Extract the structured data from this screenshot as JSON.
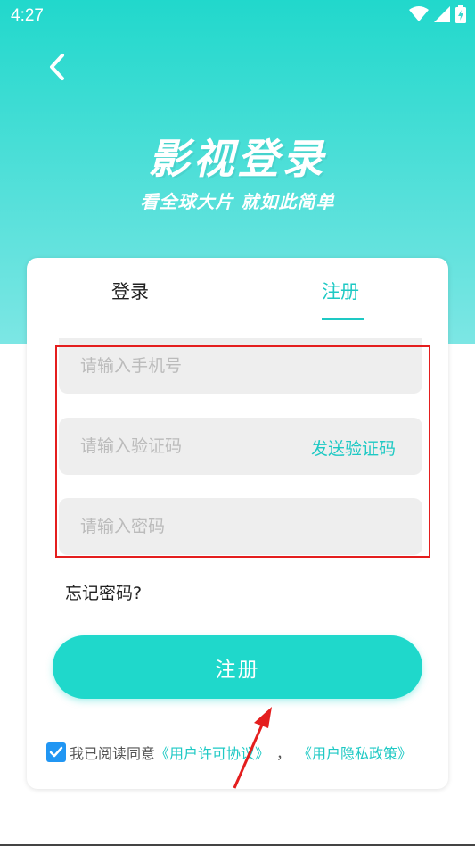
{
  "status_bar": {
    "time": "4:27"
  },
  "header": {
    "title": "影视登录",
    "subtitle": "看全球大片 就如此简单"
  },
  "tabs": {
    "login": "登录",
    "register": "注册"
  },
  "form": {
    "phone_placeholder": "请输入手机号",
    "code_placeholder": "请输入验证码",
    "send_code": "发送验证码",
    "password_placeholder": "请输入密码"
  },
  "forgot_password": "忘记密码?",
  "submit_label": "注册",
  "agreement": {
    "prefix": "我已阅读同意",
    "license": "《用户许可协议》",
    "separator": "，",
    "privacy": "《用户隐私政策》"
  },
  "colors": {
    "accent": "#1ec9c4",
    "highlight": "#e41e1e",
    "checkbox": "#2196f3"
  }
}
